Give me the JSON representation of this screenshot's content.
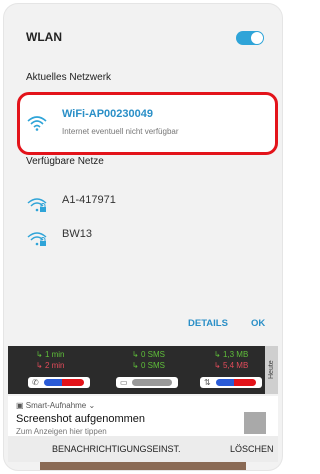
{
  "wlan": {
    "title": "WLAN",
    "toggle_on": true,
    "accent_color": "#2fa4d8"
  },
  "current_network": {
    "section_label": "Aktuelles Netzwerk",
    "name": "WiFi-AP00230049",
    "status": "Internet eventuell nicht verfügbar",
    "highlight_color": "#e3131a"
  },
  "available": {
    "section_label": "Verfügbare Netze",
    "networks": [
      {
        "name": "A1-417971",
        "icon": "wifi-lock-icon"
      },
      {
        "name": "BW13",
        "icon": "wifi-lock-icon"
      }
    ]
  },
  "buttons": {
    "details": "DETAILS",
    "ok": "OK"
  },
  "stats": {
    "heute": "Heute",
    "calls": {
      "out": "1 min",
      "in": "2 min",
      "icon": "phone-icon"
    },
    "sms": {
      "out": "0 SMS",
      "in": "0 SMS",
      "icon": "message-icon"
    },
    "data": {
      "out": "1,3 MB",
      "in": "5,4 MB",
      "icon": "mobile-data-icon"
    }
  },
  "notification": {
    "app": "Smart-Aufnahme",
    "title": "Screenshot aufgenommen",
    "text": "Zum Anzeigen hier tippen",
    "action_settings": "BENACHRICHTIGUNGSEINST.",
    "action_delete": "LÖSCHEN"
  }
}
